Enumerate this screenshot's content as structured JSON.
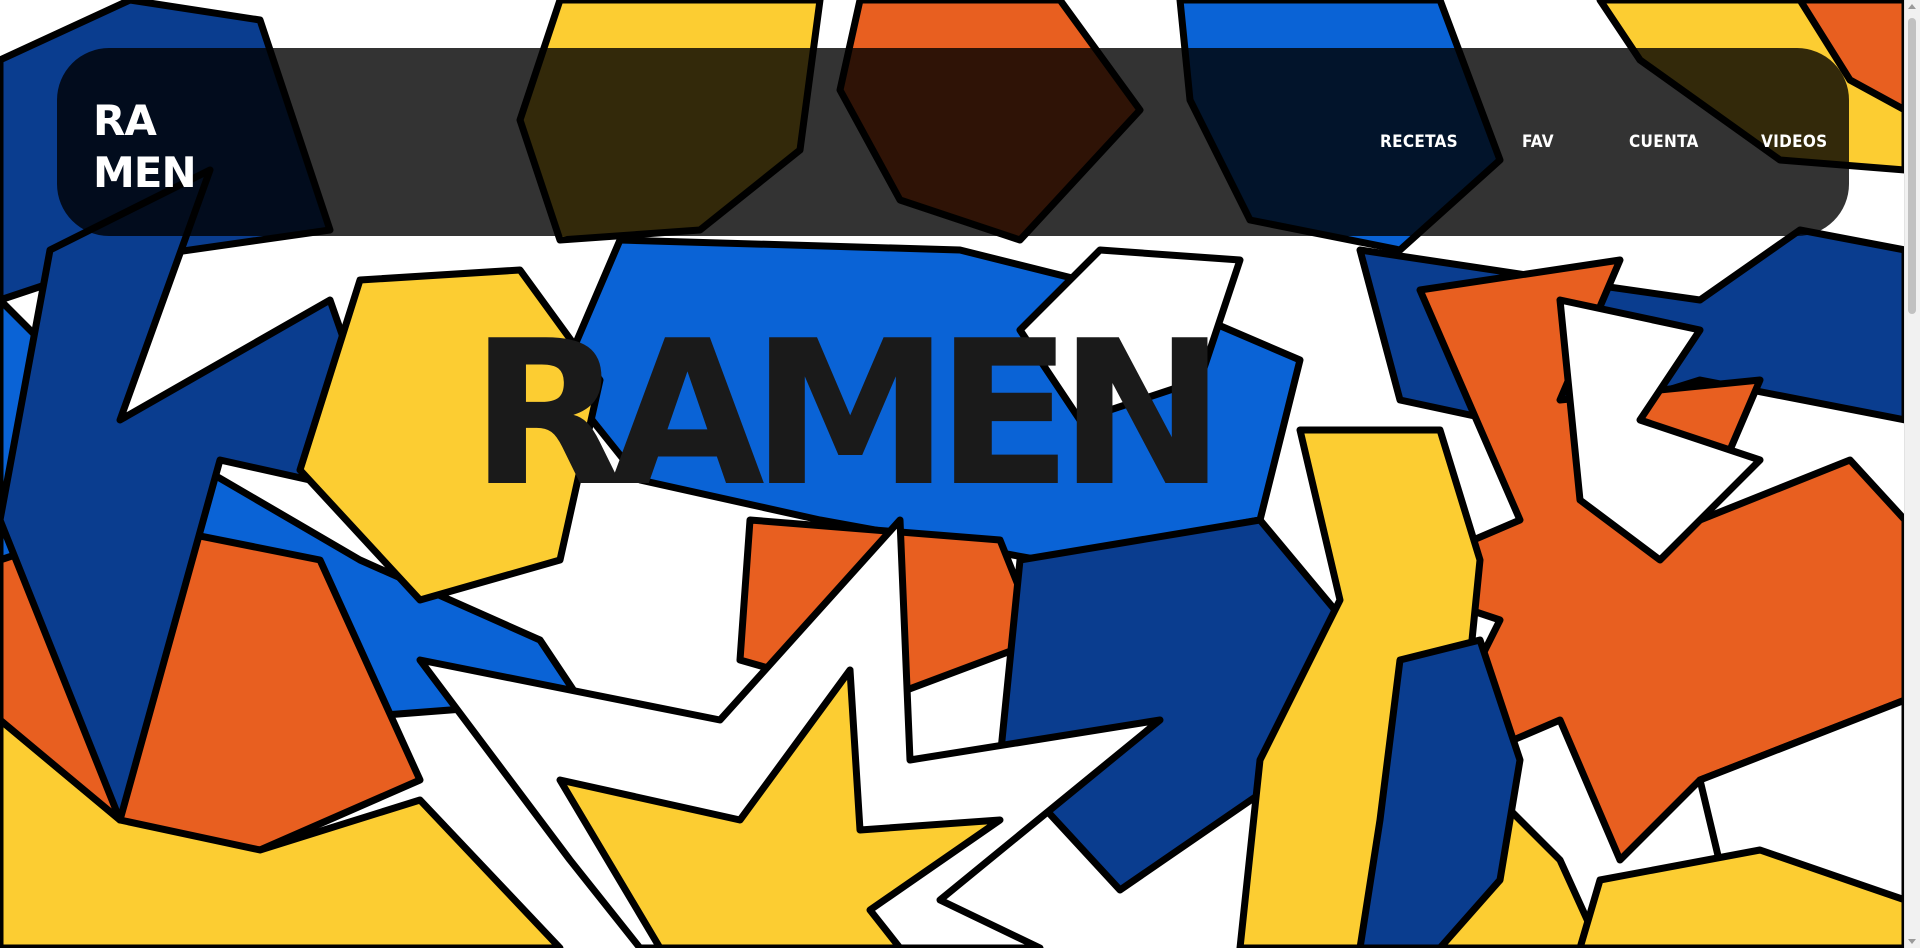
{
  "brand": {
    "logo_line1": "RA",
    "logo_line2": "MEN"
  },
  "nav": {
    "items": [
      {
        "label": "RECETAS"
      },
      {
        "label": "FAV"
      },
      {
        "label": "CUENTA"
      },
      {
        "label": "VIDEOS"
      }
    ]
  },
  "hero": {
    "title": "RAMEN"
  },
  "colors": {
    "navy": "#0a3d8f",
    "blue": "#0a63d6",
    "orange": "#e85f20",
    "yellow": "#fccd32",
    "white": "#ffffff",
    "outline": "#000000",
    "navbar_bg": "rgba(0,0,0,0.80)",
    "hero_text": "#1a1a1a"
  }
}
